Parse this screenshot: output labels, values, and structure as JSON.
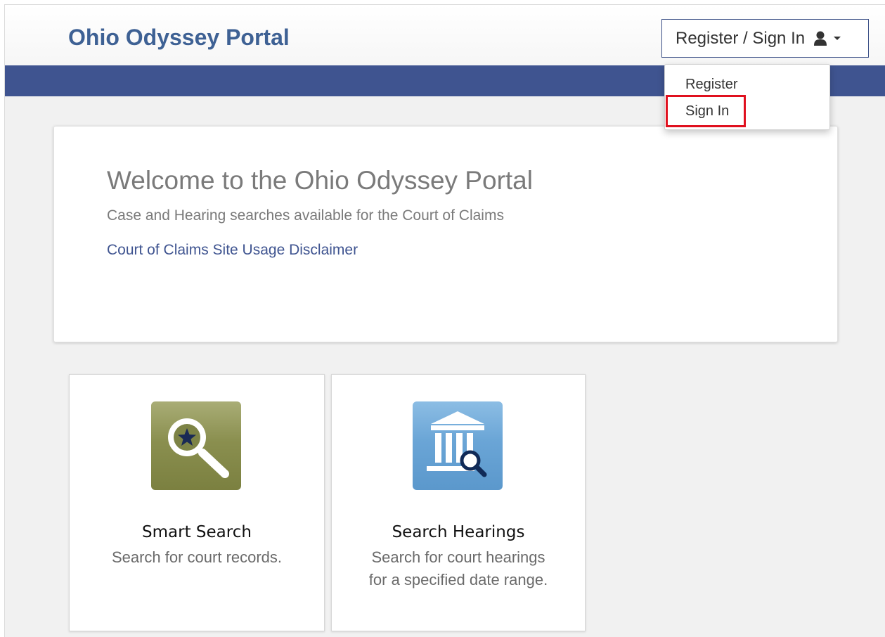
{
  "header": {
    "site_title": "Ohio Odyssey Portal",
    "auth_label": "Register / Sign In",
    "auth_icon": "user-icon",
    "caret_icon": "caret-down-icon",
    "brand_color": "#3f5490"
  },
  "dropdown": {
    "items": [
      {
        "label": "Register"
      },
      {
        "label": "Sign In",
        "highlighted": true
      }
    ],
    "highlight_color": "#e0101e"
  },
  "welcome": {
    "title": "Welcome to the Ohio Odyssey Portal",
    "subtitle": "Case and Hearing searches available for the Court of Claims",
    "link": "Court of Claims Site Usage Disclaimer"
  },
  "tiles": [
    {
      "title": "Smart Search",
      "description_lines": [
        "Search for court records."
      ],
      "icon": "magnifier-star-icon",
      "color": "#8a8f4f"
    },
    {
      "title": "Search Hearings",
      "description_lines": [
        "Search for court hearings",
        "for a specified date range."
      ],
      "icon": "courthouse-search-icon",
      "color": "#6aa5d6"
    }
  ]
}
